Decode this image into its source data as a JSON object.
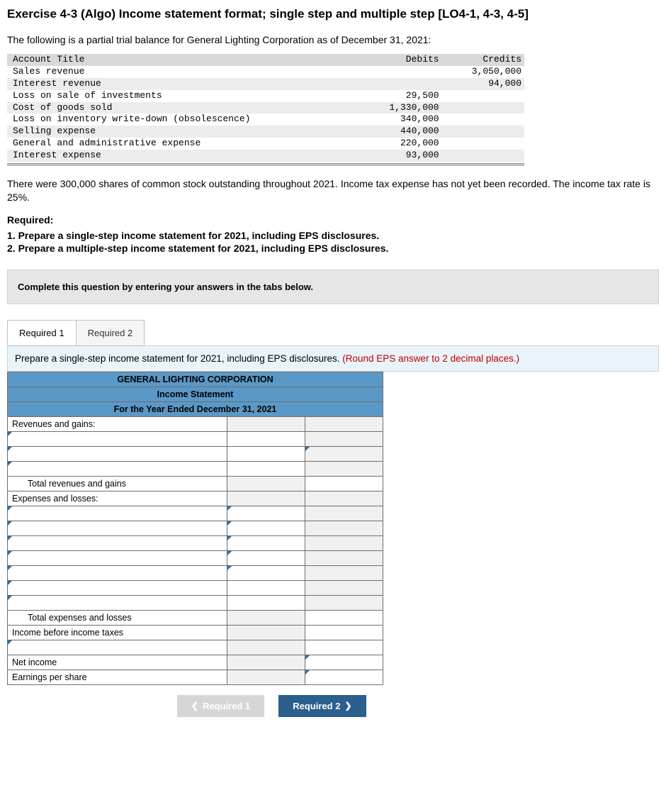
{
  "title": "Exercise 4-3 (Algo) Income statement format; single step and multiple step [LO4-1, 4-3, 4-5]",
  "intro": "The following is a partial trial balance for General Lighting Corporation as of December 31, 2021:",
  "trial": {
    "headers": {
      "title": "Account Title",
      "debits": "Debits",
      "credits": "Credits"
    },
    "rows": [
      {
        "title": "Sales revenue",
        "debits": "",
        "credits": "3,050,000"
      },
      {
        "title": "Interest revenue",
        "debits": "",
        "credits": "94,000"
      },
      {
        "title": "Loss on sale of investments",
        "debits": "29,500",
        "credits": ""
      },
      {
        "title": "Cost of goods sold",
        "debits": "1,330,000",
        "credits": ""
      },
      {
        "title": "Loss on inventory write-down (obsolescence)",
        "debits": "340,000",
        "credits": ""
      },
      {
        "title": "Selling expense",
        "debits": "440,000",
        "credits": ""
      },
      {
        "title": "General and administrative expense",
        "debits": "220,000",
        "credits": ""
      },
      {
        "title": "Interest expense",
        "debits": "93,000",
        "credits": ""
      }
    ]
  },
  "para": "There were 300,000 shares of common stock outstanding throughout 2021. Income tax expense has not yet been recorded. The income tax rate is 25%.",
  "required_label": "Required:",
  "requirements": [
    "1. Prepare a single-step income statement for 2021, including EPS disclosures.",
    "2. Prepare a multiple-step income statement for 2021, including EPS disclosures."
  ],
  "instruction": "Complete this question by entering your answers in the tabs below.",
  "tabs": {
    "t1": "Required 1",
    "t2": "Required 2"
  },
  "prompt": {
    "text": "Prepare a single-step income statement for 2021, including EPS disclosures. ",
    "hint": "(Round EPS answer to 2 decimal places.)"
  },
  "ws": {
    "h1": "GENERAL LIGHTING CORPORATION",
    "h2": "Income Statement",
    "h3": "For the Year Ended December 31, 2021",
    "rev_gains": "Revenues and gains:",
    "tot_rev": "Total revenues and gains",
    "exp_loss": "Expenses and losses:",
    "tot_exp": "Total expenses and losses",
    "ibt": "Income before income taxes",
    "ni": "Net income",
    "eps": "Earnings per share"
  },
  "nav": {
    "prev": "Required 1",
    "next": "Required 2"
  }
}
